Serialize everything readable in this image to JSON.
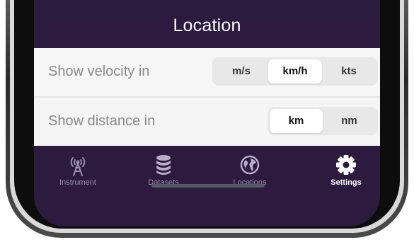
{
  "header": {
    "title": "Location"
  },
  "settings": [
    {
      "label": "Show velocity in",
      "options": [
        "m/s",
        "km/h",
        "kts"
      ],
      "selected": "km/h"
    },
    {
      "label": "Show distance in",
      "options": [
        "km",
        "nm"
      ],
      "selected": "km"
    }
  ],
  "tabbar": {
    "tabs": [
      {
        "label": "Instrument",
        "icon": "antenna-icon"
      },
      {
        "label": "Datasets",
        "icon": "database-icon"
      },
      {
        "label": "Locations",
        "icon": "globe-icon"
      },
      {
        "label": "Settings",
        "icon": "gear-icon"
      }
    ],
    "active": "Settings"
  },
  "colors": {
    "background": "#2c1a3f",
    "content": "#f5f5f5",
    "active_tab": "#ffffff",
    "inactive_tab": "#9a8fae"
  }
}
